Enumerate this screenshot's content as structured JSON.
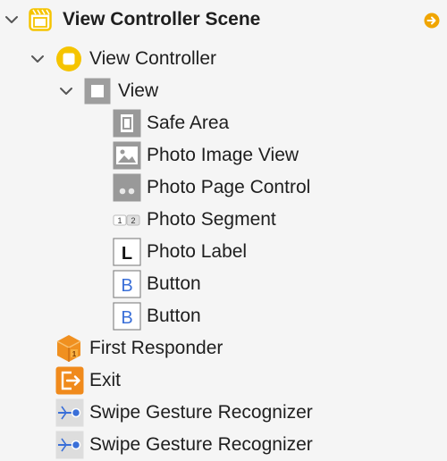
{
  "outline": {
    "scene": {
      "label": "View Controller Scene",
      "icon": "storyboard-scene-icon",
      "expanded": true,
      "has_go_to_arrow": true
    },
    "view_controller": {
      "label": "View Controller",
      "icon": "view-controller-icon",
      "expanded": true
    },
    "view": {
      "label": "View",
      "icon": "view-icon",
      "expanded": true
    },
    "subviews": [
      {
        "label": "Safe Area",
        "icon": "safe-area-icon"
      },
      {
        "label": "Photo Image View",
        "icon": "image-view-icon"
      },
      {
        "label": "Photo Page Control",
        "icon": "page-control-icon"
      },
      {
        "label": "Photo Segment",
        "icon": "segmented-control-icon"
      },
      {
        "label": "Photo Label",
        "icon": "label-icon"
      },
      {
        "label": "Button",
        "icon": "button-icon"
      },
      {
        "label": "Button",
        "icon": "button-icon"
      }
    ],
    "scene_objects": [
      {
        "label": "First Responder",
        "icon": "first-responder-icon"
      },
      {
        "label": "Exit",
        "icon": "exit-icon"
      },
      {
        "label": "Swipe Gesture Recognizer",
        "icon": "swipe-gesture-icon"
      },
      {
        "label": "Swipe Gesture Recognizer",
        "icon": "swipe-gesture-icon"
      }
    ]
  },
  "colors": {
    "accent_yellow": "#f5c400",
    "go_to_orange": "#f0a500",
    "first_responder_orange": "#f09020",
    "exit_orange": "#f08a1c",
    "button_blue": "#3a6fd8",
    "icon_gray": "#8e8e8e",
    "background": "#f5f5f5"
  }
}
